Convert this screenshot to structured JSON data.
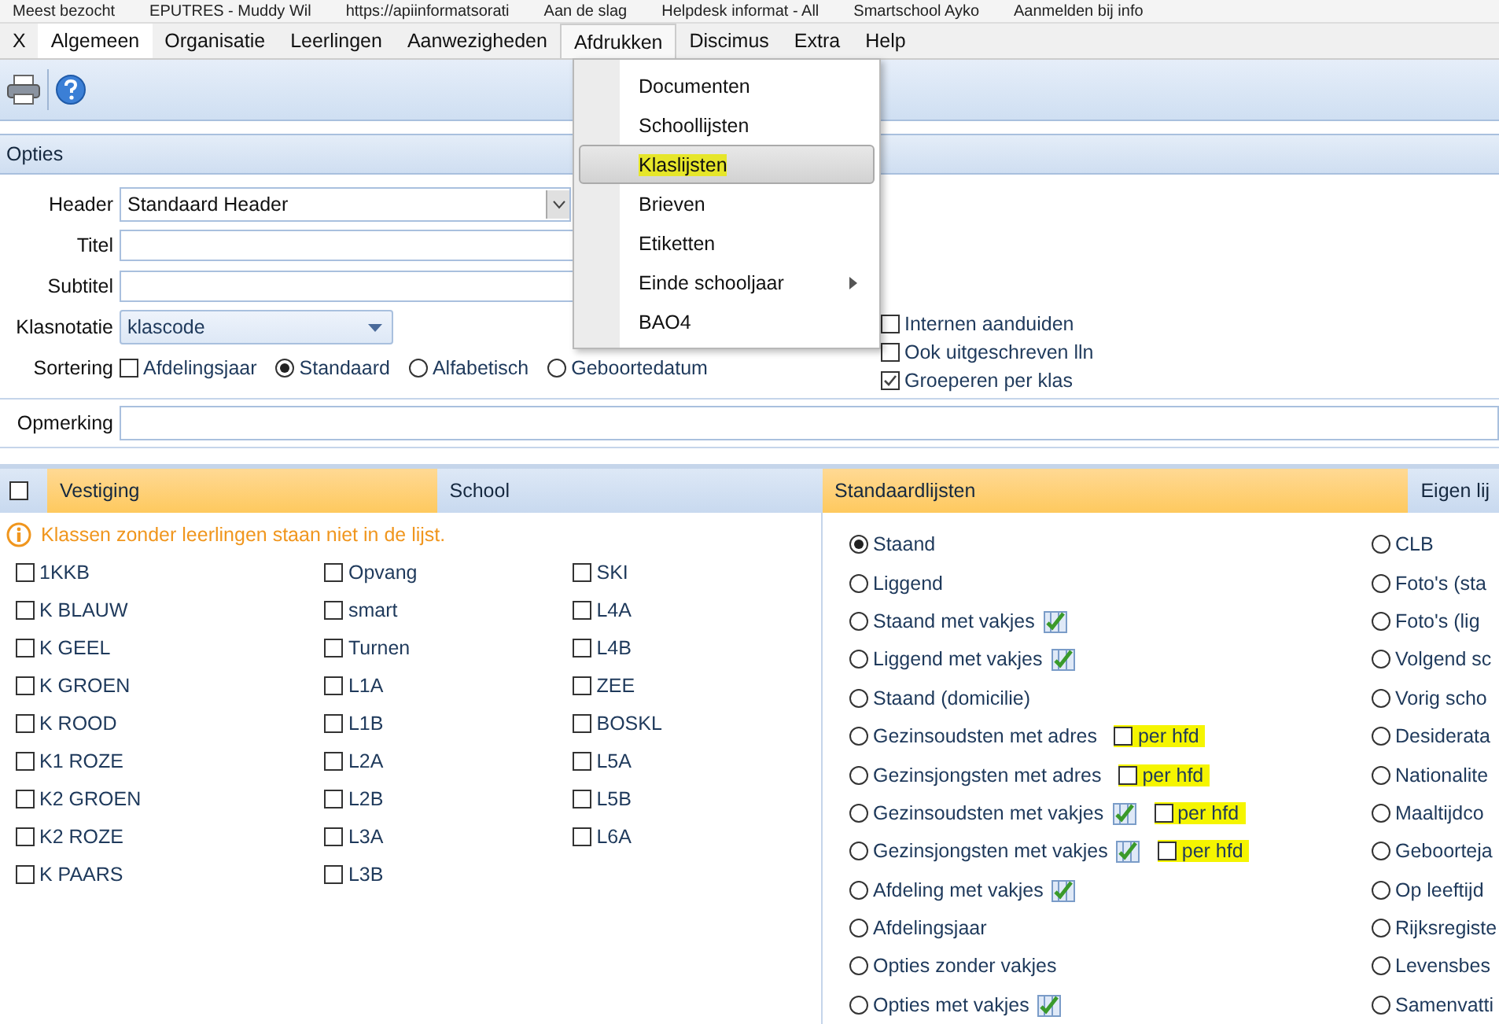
{
  "bookmarks": [
    "Meest bezocht",
    "EPUTRES - Muddy Wil",
    "https://apiinformatsorati",
    "Aan de slag",
    "Helpdesk informat - All",
    "Smartschool Ayko",
    "Aanmelden bij info"
  ],
  "menu": [
    {
      "label": "X",
      "selected": false,
      "open": false
    },
    {
      "label": "Algemeen",
      "selected": true,
      "open": false
    },
    {
      "label": "Organisatie",
      "selected": false,
      "open": false
    },
    {
      "label": "Leerlingen",
      "selected": false,
      "open": false
    },
    {
      "label": "Aanwezigheden",
      "selected": false,
      "open": false
    },
    {
      "label": "Afdrukken",
      "selected": false,
      "open": true
    },
    {
      "label": "Discimus",
      "selected": false,
      "open": false
    },
    {
      "label": "Extra",
      "selected": false,
      "open": false
    },
    {
      "label": "Help",
      "selected": false,
      "open": false
    }
  ],
  "dropdown": [
    {
      "label": "Documenten",
      "selected": false,
      "highlighted": false,
      "submenu": false
    },
    {
      "label": "Schoollijsten",
      "selected": false,
      "highlighted": false,
      "submenu": false
    },
    {
      "label": "Klaslijsten",
      "selected": true,
      "highlighted": true,
      "submenu": false
    },
    {
      "label": "Brieven",
      "selected": false,
      "highlighted": false,
      "submenu": false
    },
    {
      "label": "Etiketten",
      "selected": false,
      "highlighted": false,
      "submenu": false
    },
    {
      "label": "Einde schooljaar",
      "selected": false,
      "highlighted": false,
      "submenu": true
    },
    {
      "label": "BAO4",
      "selected": false,
      "highlighted": false,
      "submenu": false
    }
  ],
  "options_panel": {
    "title": "Opties"
  },
  "form": {
    "header": {
      "label": "Header",
      "value": "Standaard Header"
    },
    "titel": {
      "label": "Titel"
    },
    "subtitel": {
      "label": "Subtitel"
    },
    "klasnotatie": {
      "label": "Klasnotatie",
      "value": "klascode"
    },
    "sortering": {
      "label": "Sortering",
      "checkbox": {
        "label": "Afdelingsjaar",
        "checked": false
      },
      "radios": [
        {
          "label": "Standaard",
          "selected": true
        },
        {
          "label": "Alfabetisch",
          "selected": false
        },
        {
          "label": "Geboortedatum",
          "selected": false
        }
      ]
    },
    "flags": [
      {
        "label": "Internen aanduiden",
        "checked": false
      },
      {
        "label": "Ook uitgeschreven lln",
        "checked": false
      },
      {
        "label": "Groeperen per klas",
        "checked": true
      }
    ],
    "opmerking": {
      "label": "Opmerking"
    }
  },
  "left_tabs": {
    "checked": false,
    "tabs": [
      {
        "label": "Vestiging",
        "selected": true
      },
      {
        "label": "School",
        "selected": false
      }
    ]
  },
  "right_tabs": [
    {
      "label": "Standaardlijsten",
      "selected": true
    },
    {
      "label": "Eigen lij",
      "selected": false
    }
  ],
  "info": "Klassen zonder leerlingen staan niet in de lijst.",
  "classes": [
    [
      {
        "label": "1KKB",
        "checked": false
      },
      {
        "label": "K BLAUW",
        "checked": false
      },
      {
        "label": "K GEEL",
        "checked": false
      },
      {
        "label": "K GROEN",
        "checked": false
      },
      {
        "label": "K ROOD",
        "checked": false
      },
      {
        "label": "K1 ROZE",
        "checked": false
      },
      {
        "label": "K2 GROEN",
        "checked": false
      },
      {
        "label": "K2 ROZE",
        "checked": false
      },
      {
        "label": "K PAARS",
        "checked": false
      }
    ],
    [
      {
        "label": "Opvang",
        "checked": false
      },
      {
        "label": "smart",
        "checked": false
      },
      {
        "label": "Turnen",
        "checked": false
      },
      {
        "label": "L1A",
        "checked": false
      },
      {
        "label": "L1B",
        "checked": false
      },
      {
        "label": "L2A",
        "checked": false
      },
      {
        "label": "L2B",
        "checked": false
      },
      {
        "label": "L3A",
        "checked": false
      },
      {
        "label": "L3B",
        "checked": false
      }
    ],
    [
      {
        "label": "SKI",
        "checked": false
      },
      {
        "label": "L4A",
        "checked": false
      },
      {
        "label": "L4B",
        "checked": false
      },
      {
        "label": "ZEE",
        "checked": false
      },
      {
        "label": "BOSKL",
        "checked": false
      },
      {
        "label": "L5A",
        "checked": false
      },
      {
        "label": "L5B",
        "checked": false
      },
      {
        "label": "L6A",
        "checked": false
      }
    ]
  ],
  "lists": [
    [
      {
        "label": "Staand",
        "selected": true,
        "grid_icon": false
      },
      {
        "label": "Liggend",
        "selected": false,
        "grid_icon": false
      },
      {
        "label": "Staand met vakjes",
        "selected": false,
        "grid_icon": true
      },
      {
        "label": "Liggend met vakjes",
        "selected": false,
        "grid_icon": true
      },
      {
        "label": "Staand (domicilie)",
        "selected": false,
        "grid_icon": false
      },
      {
        "label": "Gezinsoudsten met adres",
        "selected": false,
        "grid_icon": false,
        "per_hfd": {
          "label": "per hfd",
          "checked": false,
          "highlighted": true
        }
      },
      {
        "label": "Gezinsjongsten met adres",
        "selected": false,
        "grid_icon": false,
        "per_hfd": {
          "label": "per hfd",
          "checked": false,
          "highlighted": true
        }
      },
      {
        "label": "Gezinsoudsten met vakjes",
        "selected": false,
        "grid_icon": true,
        "per_hfd": {
          "label": "per hfd",
          "checked": false,
          "highlighted": true
        }
      },
      {
        "label": "Gezinsjongsten met vakjes",
        "selected": false,
        "grid_icon": true,
        "per_hfd": {
          "label": "per hfd",
          "checked": false,
          "highlighted": true
        }
      },
      {
        "label": "Afdeling met vakjes",
        "selected": false,
        "grid_icon": true
      },
      {
        "label": "Afdelingsjaar",
        "selected": false,
        "grid_icon": false
      },
      {
        "label": "Opties zonder vakjes",
        "selected": false,
        "grid_icon": false
      },
      {
        "label": "Opties met vakjes",
        "selected": false,
        "grid_icon": true
      }
    ],
    [
      {
        "label": "CLB",
        "selected": false,
        "grid_icon": false
      },
      {
        "label": "Foto's (sta",
        "selected": false,
        "grid_icon": false
      },
      {
        "label": "Foto's (lig",
        "selected": false,
        "grid_icon": false
      },
      {
        "label": "Volgend sc",
        "selected": false,
        "grid_icon": false
      },
      {
        "label": "Vorig scho",
        "selected": false,
        "grid_icon": false
      },
      {
        "label": "Desiderata",
        "selected": false,
        "grid_icon": false
      },
      {
        "label": "Nationalite",
        "selected": false,
        "grid_icon": false
      },
      {
        "label": "Maaltijdco",
        "selected": false,
        "grid_icon": false
      },
      {
        "label": "Geboorteja",
        "selected": false,
        "grid_icon": false
      },
      {
        "label": "Op leeftijd",
        "selected": false,
        "grid_icon": false
      },
      {
        "label": "Rijksregiste",
        "selected": false,
        "grid_icon": false
      },
      {
        "label": "Levensbes",
        "selected": false,
        "grid_icon": false
      },
      {
        "label": "Samenvatti",
        "selected": false,
        "grid_icon": false
      }
    ]
  ]
}
